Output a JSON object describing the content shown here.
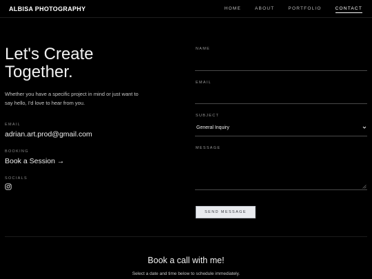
{
  "brand": "ALBISA PHOTOGRAPHY",
  "nav": {
    "items": [
      {
        "label": "HOME"
      },
      {
        "label": "ABOUT"
      },
      {
        "label": "PORTFOLIO"
      },
      {
        "label": "CONTACT"
      }
    ],
    "active": "CONTACT"
  },
  "hero": {
    "title_line1": "Let's Create",
    "title_line2": "Together.",
    "intro": "Whether you have a specific project in mind or just want to say hello, I'd love to hear from you."
  },
  "contact": {
    "email_label": "EMAIL",
    "email_value": "adrian.art.prod@gmail.com",
    "booking_label": "BOOKING",
    "booking_link": "Book a Session →",
    "socials_label": "SOCIALS",
    "social_icon": "instagram-icon"
  },
  "form": {
    "name_label": "NAME",
    "name_value": "",
    "email_label": "EMAIL",
    "email_value": "",
    "subject_label": "SUBJECT",
    "subject_value": "General Inquiry",
    "message_label": "MESSAGE",
    "message_value": "",
    "send_label": "SEND MESSAGE"
  },
  "book_call": {
    "title": "Book a call with me!",
    "subtitle": "Select a date and time below to schedule immediately."
  },
  "colors": {
    "background": "#000000",
    "text": "#e8e8e8",
    "button_bg": "#e9ebef"
  }
}
